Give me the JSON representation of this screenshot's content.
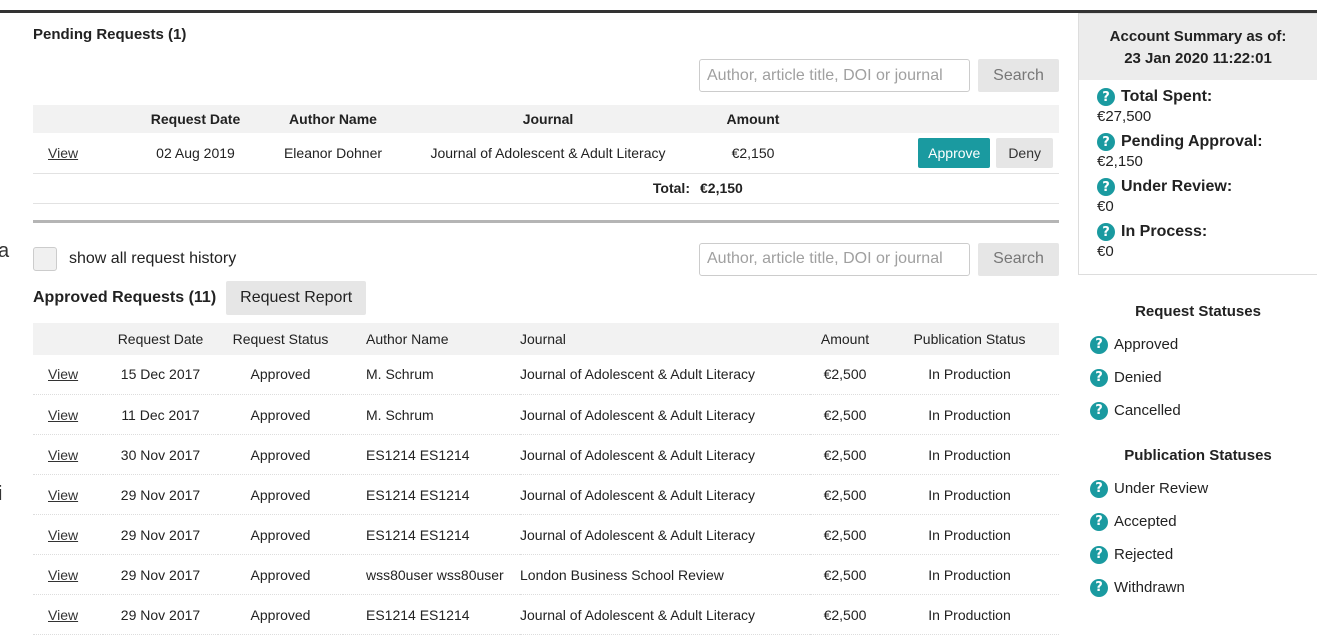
{
  "pending": {
    "title": "Pending Requests (1)",
    "search_placeholder": "Author, article title, DOI or journal",
    "search_label": "Search",
    "headers": [
      "",
      "Request Date",
      "Author Name",
      "Journal",
      "Amount",
      ""
    ],
    "rows": [
      {
        "view": "View",
        "date": "02 Aug 2019",
        "author": "Eleanor Dohner",
        "journal": "Journal of Adolescent & Adult Literacy",
        "amount": "€2,150",
        "approve": "Approve",
        "deny": "Deny"
      }
    ],
    "total_label": "Total:",
    "total_value": "€2,150"
  },
  "history": {
    "checkbox_label": "show all request history",
    "search_placeholder": "Author, article title, DOI or journal",
    "search_label": "Search"
  },
  "approved": {
    "title": "Approved Requests (11)",
    "report_label": "Request Report",
    "headers": [
      "",
      "Request Date",
      "Request Status",
      "Author Name",
      "Journal",
      "Amount",
      "Publication Status"
    ],
    "rows": [
      {
        "view": "View",
        "date": "15 Dec 2017",
        "status": "Approved",
        "author": "M. Schrum",
        "journal": "Journal of Adolescent & Adult Literacy",
        "amount": "€2,500",
        "pub_status": "In Production"
      },
      {
        "view": "View",
        "date": "11 Dec 2017",
        "status": "Approved",
        "author": "M. Schrum",
        "journal": "Journal of Adolescent & Adult Literacy",
        "amount": "€2,500",
        "pub_status": "In Production"
      },
      {
        "view": "View",
        "date": "30 Nov 2017",
        "status": "Approved",
        "author": "ES1214 ES1214",
        "journal": "Journal of Adolescent & Adult Literacy",
        "amount": "€2,500",
        "pub_status": "In Production"
      },
      {
        "view": "View",
        "date": "29 Nov 2017",
        "status": "Approved",
        "author": "ES1214 ES1214",
        "journal": "Journal of Adolescent & Adult Literacy",
        "amount": "€2,500",
        "pub_status": "In Production"
      },
      {
        "view": "View",
        "date": "29 Nov 2017",
        "status": "Approved",
        "author": "ES1214 ES1214",
        "journal": "Journal of Adolescent & Adult Literacy",
        "amount": "€2,500",
        "pub_status": "In Production"
      },
      {
        "view": "View",
        "date": "29 Nov 2017",
        "status": "Approved",
        "author": "wss80user wss80user",
        "journal": "London Business School Review",
        "amount": "€2,500",
        "pub_status": "In Production"
      },
      {
        "view": "View",
        "date": "29 Nov 2017",
        "status": "Approved",
        "author": "ES1214 ES1214",
        "journal": "Journal of Adolescent & Adult Literacy",
        "amount": "€2,500",
        "pub_status": "In Production"
      }
    ]
  },
  "summary": {
    "title_line1": "Account Summary as of:",
    "title_line2": "23 Jan 2020 11:22:01",
    "items": [
      {
        "label": "Total Spent:",
        "value": "€27,500"
      },
      {
        "label": "Pending Approval:",
        "value": "€2,150"
      },
      {
        "label": "Under Review:",
        "value": "€0"
      },
      {
        "label": "In Process:",
        "value": "€0"
      }
    ]
  },
  "request_statuses": {
    "title": "Request Statuses",
    "items": [
      "Approved",
      "Denied",
      "Cancelled"
    ]
  },
  "publication_statuses": {
    "title": "Publication Statuses",
    "items": [
      "Under Review",
      "Accepted",
      "Rejected",
      "Withdrawn"
    ]
  },
  "edge_glyphs": [
    "a",
    "i"
  ],
  "colors": {
    "accent": "#1a9aa0",
    "header_bg": "#f2f2f2",
    "button_bg": "#e6e6e6"
  },
  "icons": {
    "help": "question-circle-icon"
  }
}
